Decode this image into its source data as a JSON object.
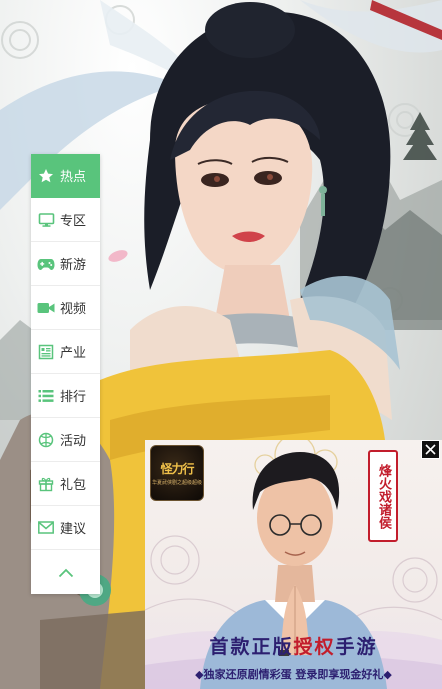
{
  "sidebar": {
    "items": [
      {
        "label": "热点",
        "icon": "star-icon",
        "active": true
      },
      {
        "label": "专区",
        "icon": "monitor-icon"
      },
      {
        "label": "新游",
        "icon": "gamepad-icon"
      },
      {
        "label": "视频",
        "icon": "video-camera-icon"
      },
      {
        "label": "产业",
        "icon": "newspaper-icon"
      },
      {
        "label": "排行",
        "icon": "list-icon"
      },
      {
        "label": "活动",
        "icon": "ball-icon"
      },
      {
        "label": "礼包",
        "icon": "gift-icon"
      },
      {
        "label": "建议",
        "icon": "envelope-icon"
      }
    ],
    "back_to_top_icon": "chevron-up-icon",
    "accent_color": "#59c47c",
    "icon_color": "#59c47c"
  },
  "ad": {
    "game_logo_text": "怪力行",
    "game_logo_subtext": "华夏武侠剧之超级超级",
    "seal_text": "烽火戏诸侯",
    "slogan_part1": "首款正版",
    "slogan_highlight": "授权",
    "slogan_part2": "手游",
    "sub_slogan": "◆独家还原剧情彩蛋 登录即享现金好礼◆",
    "close_icon": "close-icon"
  }
}
